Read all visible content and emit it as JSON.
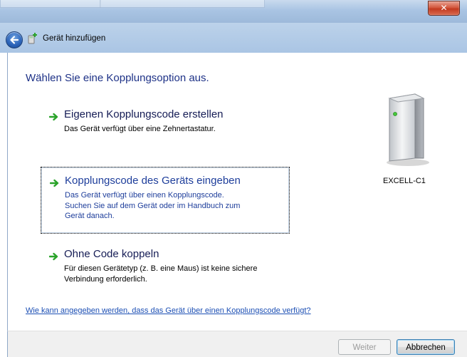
{
  "window": {
    "close_glyph": "✕"
  },
  "nav": {
    "title": "Gerät hinzufügen"
  },
  "main": {
    "heading": "Wählen Sie eine Kopplungsoption aus.",
    "options": [
      {
        "title": "Eigenen Kopplungscode erstellen",
        "lines": [
          "Das Gerät verfügt über eine Zehnertastatur."
        ]
      },
      {
        "title": "Kopplungscode des Geräts eingeben",
        "lines": [
          "Das Gerät verfügt über einen Kopplungscode.",
          "Suchen Sie auf dem Gerät oder im Handbuch zum",
          "Gerät danach."
        ]
      },
      {
        "title": "Ohne Code koppeln",
        "lines": [
          "Für diesen Gerätetyp (z. B. eine Maus) ist keine sichere",
          "Verbindung erforderlich."
        ]
      }
    ],
    "device_name": "EXCELL-C1",
    "help_link": "Wie kann angegeben werden, dass das Gerät über einen Kopplungscode verfügt?"
  },
  "footer": {
    "next_label": "Weiter",
    "cancel_label": "Abbrechen"
  },
  "colors": {
    "heading": "#1e3287",
    "link": "#1c4fb4",
    "arrow": "#2aa32a"
  }
}
